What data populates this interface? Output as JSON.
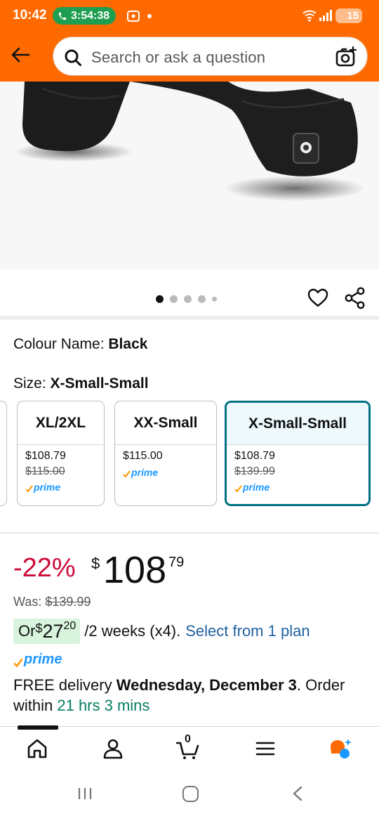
{
  "status_bar": {
    "time": "10:42",
    "call_timer": "3:54:38",
    "battery": "15"
  },
  "search": {
    "placeholder": "Search or ask a question"
  },
  "product_image": {
    "alt": "Black heated gloves product image",
    "dots_count": 5,
    "active_dot": 0
  },
  "variation": {
    "colour_label": "Colour Name: ",
    "colour_value": "Black",
    "size_label": "Size: ",
    "size_value": "X-Small-Small"
  },
  "sizes": [
    {
      "name": "XL/2XL",
      "price": "$108.79",
      "list_price": "$115.00",
      "prime": "prime",
      "selected": false
    },
    {
      "name": "XX-Small",
      "price": "$115.00",
      "list_price": "",
      "prime": "prime",
      "selected": false
    },
    {
      "name": "X-Small-Small",
      "price": "$108.79",
      "list_price": "$139.99",
      "prime": "prime",
      "selected": true
    }
  ],
  "pricing": {
    "discount": "-22%",
    "currency": "$",
    "whole": "108",
    "fraction": "79",
    "was_label": "Was: ",
    "was_price": "$139.99"
  },
  "installment": {
    "prefix": "Or ",
    "currency": "$",
    "whole": "27",
    "fraction": "20",
    "rest": "/2 weeks (x4).",
    "link": "Select from 1 plan"
  },
  "prime_label": "prime",
  "delivery": {
    "part1": "FREE delivery ",
    "date": "Wednesday, December 3",
    "part2": ". Order within ",
    "countdown": "21 hrs 3 mins"
  },
  "bottom_nav": {
    "cart_count": "0",
    "items": [
      "home-icon",
      "account-icon",
      "cart-icon",
      "menu-icon",
      "rufus-icon"
    ]
  },
  "colors": {
    "header": "#ff6a00",
    "accent_teal": "#007185",
    "deal_red": "#cc0c39",
    "link_blue": "#2162a1",
    "green": "#067d62",
    "prime_blue": "#1a98ff"
  }
}
